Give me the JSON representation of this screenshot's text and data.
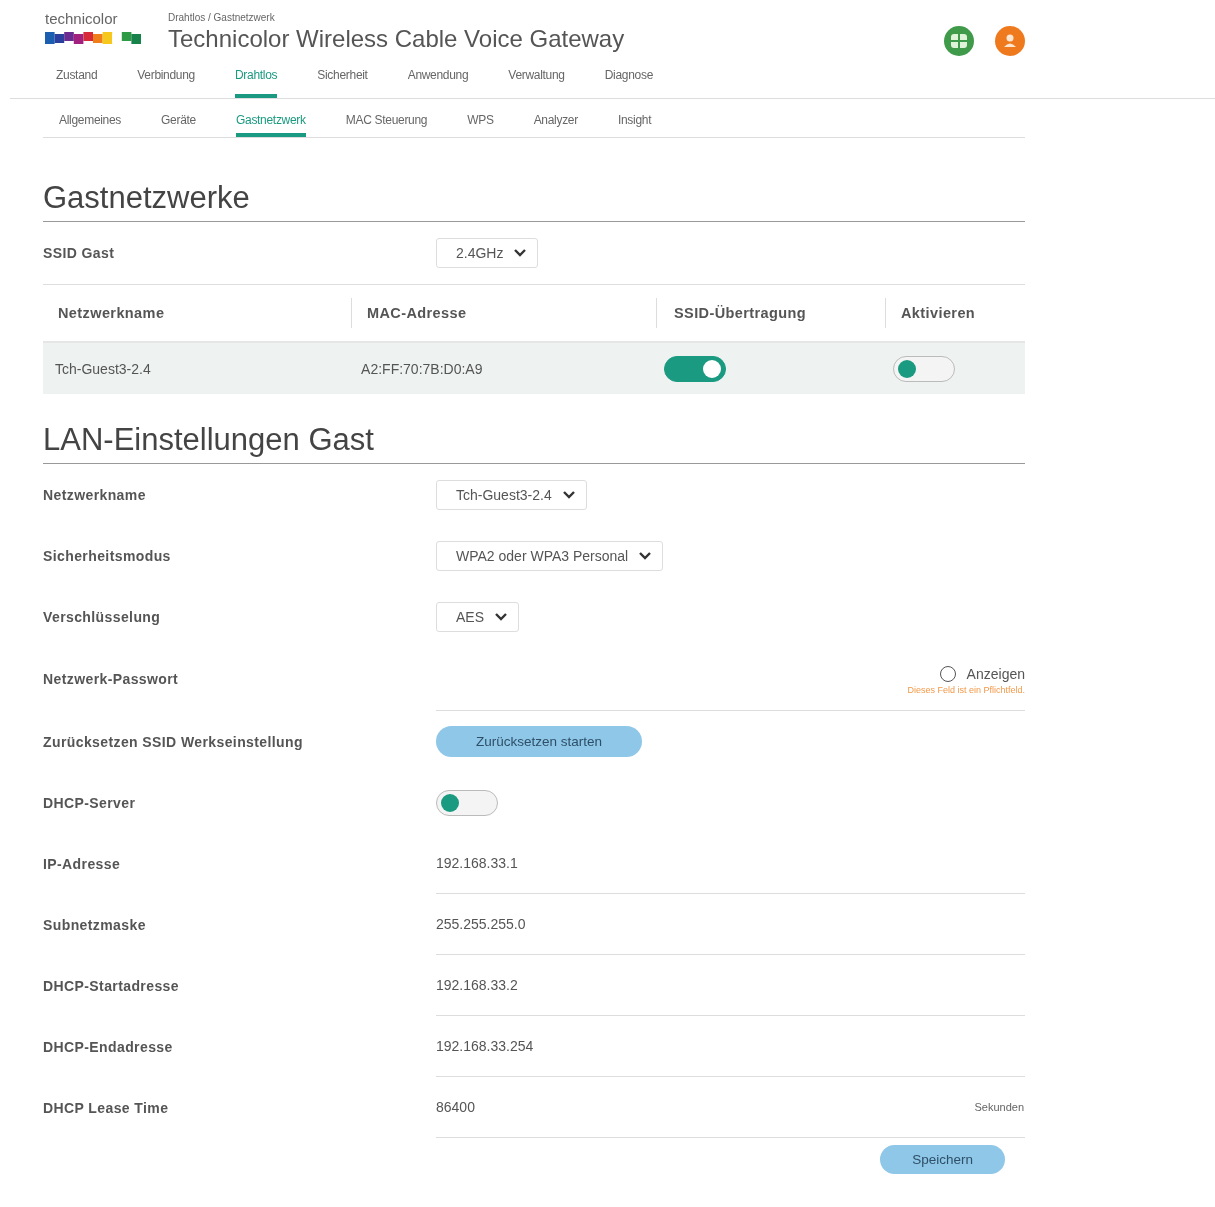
{
  "header": {
    "logo_text": "technicolor",
    "breadcrumb": "Drahtlos / Gastnetzwerk",
    "title": "Technicolor Wireless Cable Voice Gateway"
  },
  "main_nav": [
    {
      "label": "Zustand",
      "selected": false
    },
    {
      "label": "Verbindung",
      "selected": false
    },
    {
      "label": "Drahtlos",
      "selected": true
    },
    {
      "label": "Sicherheit",
      "selected": false
    },
    {
      "label": "Anwendung",
      "selected": false
    },
    {
      "label": "Verwaltung",
      "selected": false
    },
    {
      "label": "Diagnose",
      "selected": false
    }
  ],
  "sub_nav": [
    {
      "label": "Allgemeines",
      "selected": false
    },
    {
      "label": "Geräte",
      "selected": false
    },
    {
      "label": "Gastnetzwerk",
      "selected": true
    },
    {
      "label": "MAC Steuerung",
      "selected": false
    },
    {
      "label": "WPS",
      "selected": false
    },
    {
      "label": "Analyzer",
      "selected": false
    },
    {
      "label": "Insight",
      "selected": false
    }
  ],
  "guest_section": {
    "heading": "Gastnetzwerke",
    "ssid_label": "SSID Gast",
    "ssid_value": "2.4GHz",
    "table": {
      "columns": [
        "Netzwerkname",
        "MAC-Adresse",
        "SSID-Übertragung",
        "Aktivieren"
      ],
      "rows": [
        {
          "name": "Tch-Guest3-2.4",
          "mac": "A2:FF:70:7B:D0:A9",
          "broadcast": true,
          "enabled": false
        }
      ]
    }
  },
  "lan_section": {
    "heading": "LAN-Einstellungen Gast",
    "rows": [
      {
        "kind": "select",
        "label": "Netzwerkname",
        "value": "Tch-Guest3-2.4"
      },
      {
        "kind": "select",
        "label": "Sicherheitsmodus",
        "value": "WPA2 oder WPA3 Personal"
      },
      {
        "kind": "select",
        "label": "Verschlüsselung",
        "value": "AES"
      },
      {
        "kind": "password",
        "label": "Netzwerk-Passwort",
        "show_label": "Anzeigen",
        "show_checked": false,
        "error": "Dieses Feld ist ein Pflichtfeld."
      },
      {
        "kind": "button",
        "label": "Zurücksetzen SSID Werkseinstellung",
        "button": "Zurücksetzen starten"
      },
      {
        "kind": "toggle",
        "label": "DHCP-Server",
        "on": false
      },
      {
        "kind": "text",
        "label": "IP-Adresse",
        "value": "192.168.33.1"
      },
      {
        "kind": "text",
        "label": "Subnetzmaske",
        "value": "255.255.255.0"
      },
      {
        "kind": "text",
        "label": "DHCP-Startadresse",
        "value": "192.168.33.2"
      },
      {
        "kind": "text",
        "label": "DHCP-Endadresse",
        "value": "192.168.33.254"
      },
      {
        "kind": "text",
        "label": "DHCP Lease Time",
        "value": "86400",
        "unit": "Sekunden"
      }
    ]
  },
  "save_button": "Speichern"
}
